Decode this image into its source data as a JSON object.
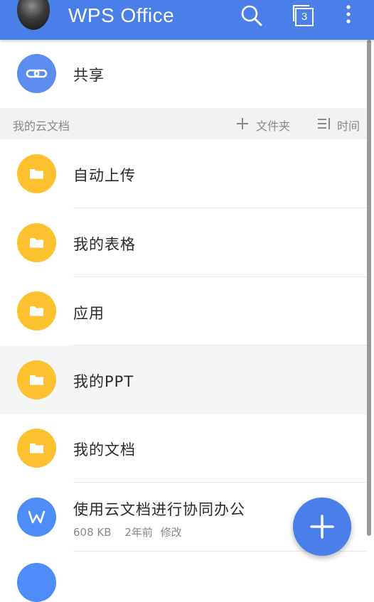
{
  "appbar": {
    "title": "WPS Office",
    "tab_count": "3",
    "icons": [
      "avatar",
      "search-icon",
      "tabs-icon",
      "more-vert-icon"
    ]
  },
  "shared": {
    "label": "共享",
    "icon": "link-icon",
    "color": "#5b8def"
  },
  "section": {
    "title": "我的云文档",
    "new_folder_label": "文件夹",
    "sort_label": "时间"
  },
  "folders": [
    {
      "label": "自动上传"
    },
    {
      "label": "我的表格"
    },
    {
      "label": "应用"
    },
    {
      "label": "我的PPT"
    },
    {
      "label": "我的文档"
    }
  ],
  "file": {
    "label": "使用云文档进行协同办公",
    "size": "608 KB",
    "time": "2年前",
    "action": "修改",
    "icon": "wps-writer-icon"
  },
  "colors": {
    "accent": "#4a7ee9",
    "folder": "#fdc12f",
    "file_icon": "#4e8cf7",
    "section_bg": "#f2f2f2",
    "highlight_row": "#f5f5f5"
  }
}
